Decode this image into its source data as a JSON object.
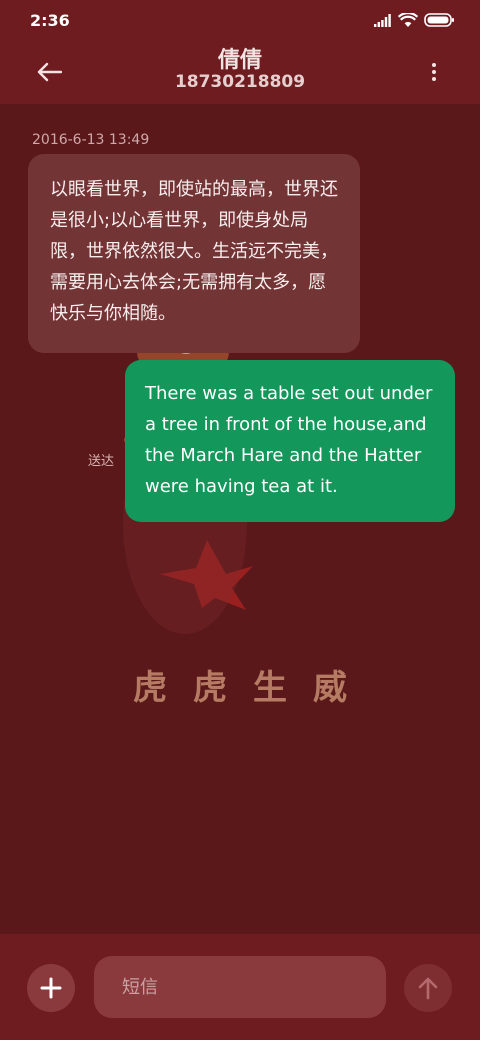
{
  "status": {
    "time": "2:36"
  },
  "header": {
    "title": "倩倩",
    "phone": "18730218809"
  },
  "conversation": {
    "timestamp": "2016-6-13 13:49",
    "incoming": "以眼看世界，即使站的最高，世界还是很小;以心看世界，即使身处局限，世界依然很大。生活远不完美，需要用心去体会;无需拥有太多，愿快乐与你相随。",
    "delivered": "送达",
    "outgoing": "There was a table set out under a tree in front of the house,and the March Hare and the Hatter were having tea at it."
  },
  "background": {
    "tagline": "虎虎生威"
  },
  "composer": {
    "placeholder": "短信"
  },
  "colors": {
    "bar": "#6f1c20",
    "chat_bg": "#5a181b",
    "incoming_bubble": "#733435",
    "outgoing_bubble": "#14975a"
  },
  "icons": [
    "signal-icon",
    "wifi-icon",
    "battery-icon",
    "back-arrow-icon",
    "more-vert-icon",
    "plus-icon",
    "send-arrow-icon"
  ]
}
